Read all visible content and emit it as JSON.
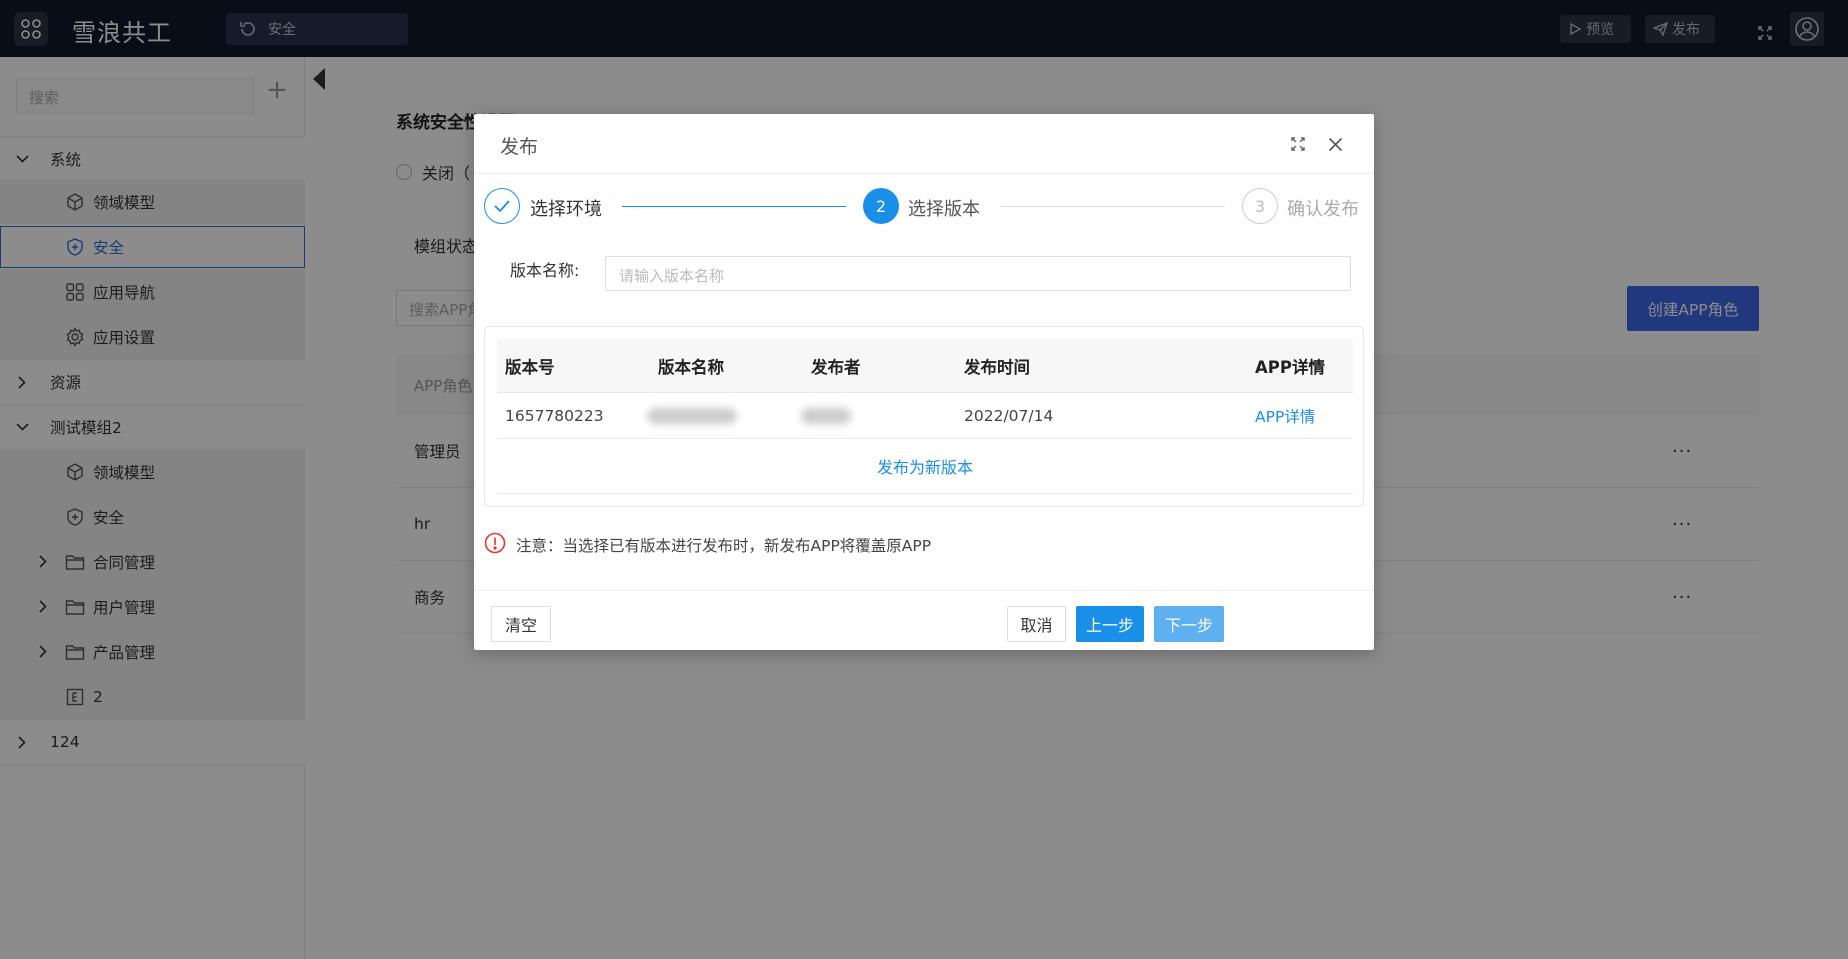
{
  "topbar": {
    "app_name": "雪浪共工",
    "selector_label": "安全",
    "preview_label": "预览",
    "publish_label": "发布"
  },
  "sidebar": {
    "search_placeholder": "搜索",
    "items": [
      {
        "label": "系统",
        "type": "group",
        "expanded": true
      },
      {
        "label": "领域模型",
        "type": "child",
        "icon": "cube-icon"
      },
      {
        "label": "安全",
        "type": "child",
        "icon": "shield-plus-icon",
        "selected": true
      },
      {
        "label": "应用导航",
        "type": "child",
        "icon": "grid-icon"
      },
      {
        "label": "应用设置",
        "type": "child",
        "icon": "gear-icon"
      },
      {
        "label": "资源",
        "type": "group",
        "expanded": false
      },
      {
        "label": "测试模组2",
        "type": "group",
        "expanded": true
      },
      {
        "label": "领域模型",
        "type": "child",
        "icon": "cube-icon"
      },
      {
        "label": "安全",
        "type": "child",
        "icon": "shield-plus-icon"
      },
      {
        "label": "合同管理",
        "type": "child-folder",
        "icon": "folder-icon"
      },
      {
        "label": "用户管理",
        "type": "child-folder",
        "icon": "folder-icon"
      },
      {
        "label": "产品管理",
        "type": "child-folder",
        "icon": "folder-icon"
      },
      {
        "label": "2",
        "type": "child",
        "icon": "entity-icon"
      },
      {
        "label": "124",
        "type": "group",
        "expanded": false
      }
    ]
  },
  "main": {
    "title": "系统安全性设置",
    "radio_label": "关闭（",
    "module_status_label": "模组状态",
    "search_placeholder": "搜索APP角",
    "create_button": "创建APP角色",
    "table_header": "APP角色",
    "rows": [
      "管理员",
      "hr",
      "商务"
    ],
    "more": "···"
  },
  "modal": {
    "title": "发布",
    "steps": [
      {
        "number": "1",
        "label": "选择环境",
        "status": "done"
      },
      {
        "number": "2",
        "label": "选择版本",
        "status": "active"
      },
      {
        "number": "3",
        "label": "确认发布",
        "status": "waiting"
      }
    ],
    "version_name_label": "版本名称:",
    "version_name_placeholder": "请输入版本名称",
    "table": {
      "columns": [
        "版本号",
        "版本名称",
        "发布者",
        "发布时间",
        "APP详情"
      ],
      "rows": [
        {
          "version": "1657780223",
          "name": "",
          "publisher": "",
          "time": "2022/07/14",
          "detail": "APP详情"
        }
      ],
      "publish_new": "发布为新版本"
    },
    "notice": "注意：当选择已有版本进行发布时，新发布APP将覆盖原APP",
    "buttons": {
      "clear": "清空",
      "cancel": "取消",
      "prev": "上一步",
      "next": "下一步"
    }
  },
  "colors": {
    "primary": "#1a8fe8",
    "topbar": "#0f1a2c",
    "create_button": "#3d65e6",
    "danger": "#e5352f"
  }
}
